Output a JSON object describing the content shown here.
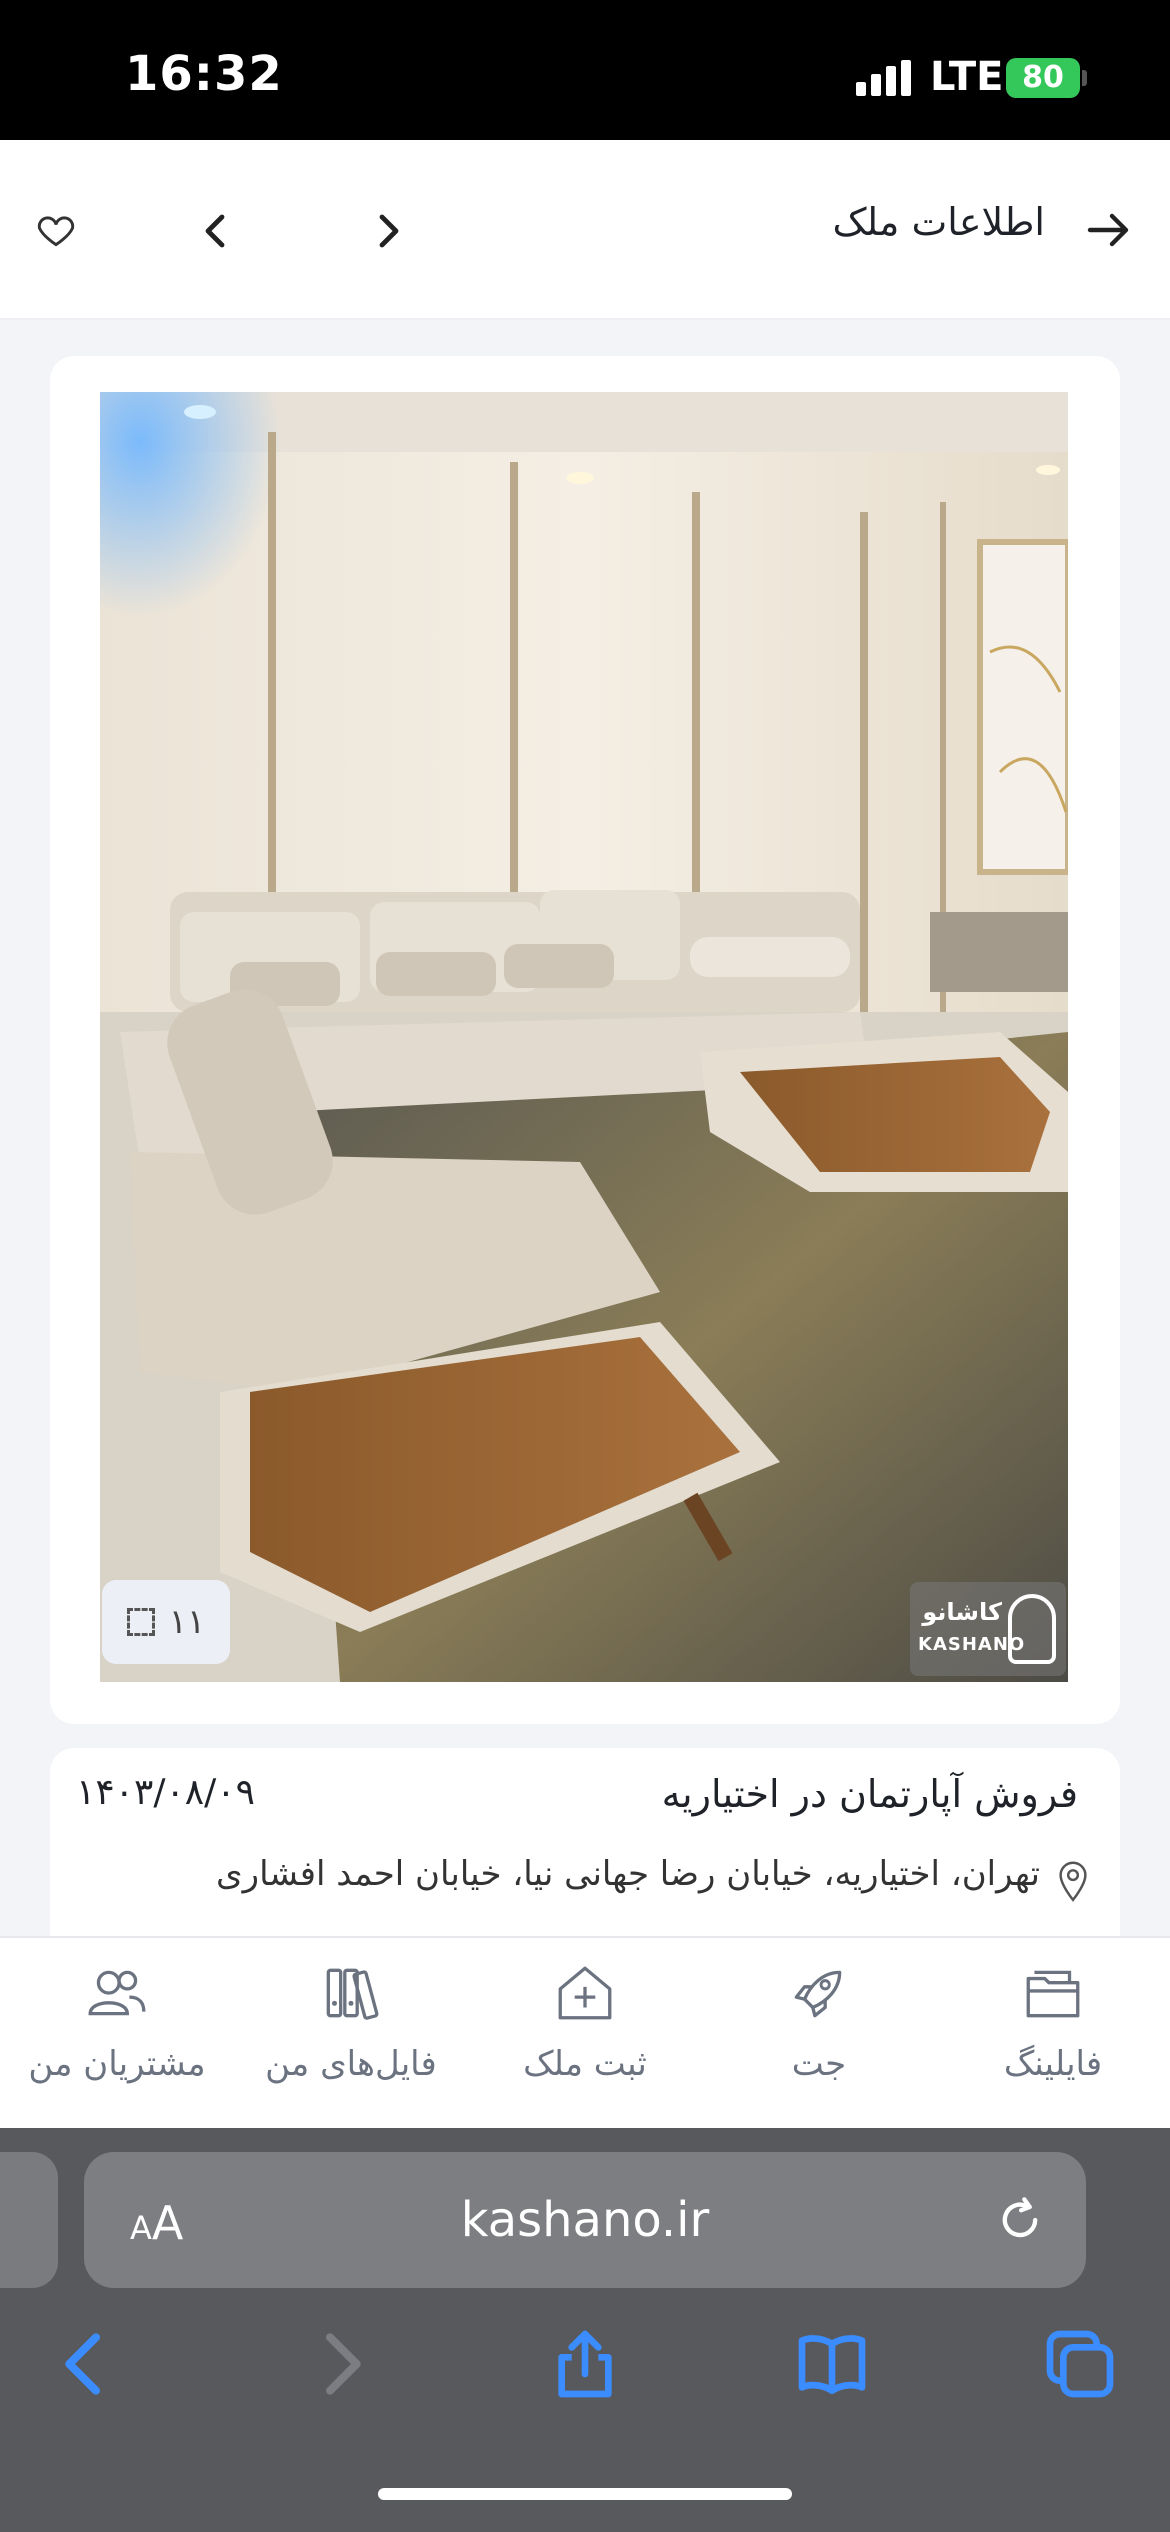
{
  "status_bar": {
    "time": "16:32",
    "network": "LTE",
    "battery": "80"
  },
  "header": {
    "title": "اطلاعات ملک"
  },
  "photo": {
    "counter": "۱۱",
    "watermark_fa": "کاشانو",
    "watermark_en": "KASHANO"
  },
  "listing": {
    "title": "فروش آپارتمان در اختیاریه",
    "date": "۱۴۰۳/۰۸/۰۹",
    "address": "تهران، اختیاریه، خیابان رضا جهانی نیا، خیابان احمد افشاری"
  },
  "bottom_nav": {
    "items": [
      {
        "label": "مشتریان من",
        "icon": "users-icon"
      },
      {
        "label": "فایل‌های من",
        "icon": "files-icon"
      },
      {
        "label": "ثبت ملک",
        "icon": "add-property-icon"
      },
      {
        "label": "جت",
        "icon": "rocket-icon"
      },
      {
        "label": "فایلینگ",
        "icon": "folder-icon"
      }
    ]
  },
  "browser": {
    "aa_label_small": "A",
    "aa_label_large": "A",
    "url": "kashano.ir",
    "accent_color": "#3b8cff"
  }
}
